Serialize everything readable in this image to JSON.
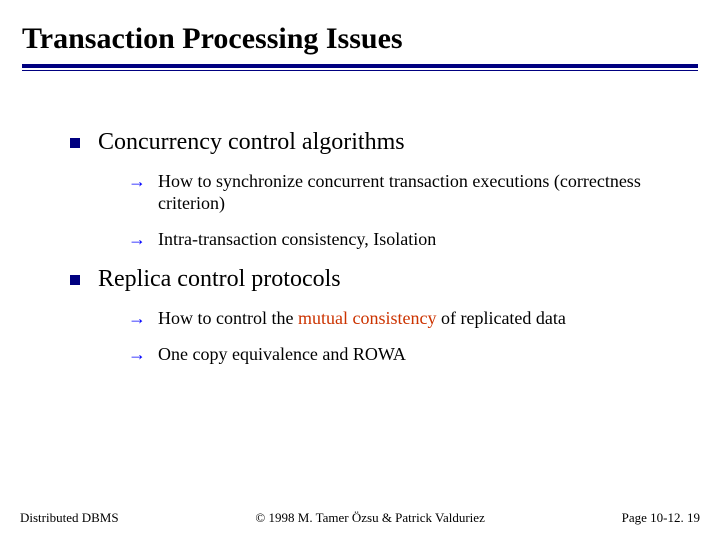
{
  "title": "Transaction Processing Issues",
  "items": [
    {
      "text": "Concurrency control algorithms",
      "sub": [
        {
          "text": "How to synchronize concurrent transaction executions (correctness criterion)"
        },
        {
          "text": "Intra-transaction consistency, Isolation"
        }
      ]
    },
    {
      "text": "Replica control protocols",
      "sub": [
        {
          "prefix": "How to control the ",
          "emph": "mutual consistency",
          "suffix": " of replicated data"
        },
        {
          "text": "One copy equivalence and ROWA"
        }
      ]
    }
  ],
  "footer": {
    "left": "Distributed DBMS",
    "center": "© 1998 M. Tamer Özsu & Patrick Valduriez",
    "right": "Page 10-12. 19"
  }
}
